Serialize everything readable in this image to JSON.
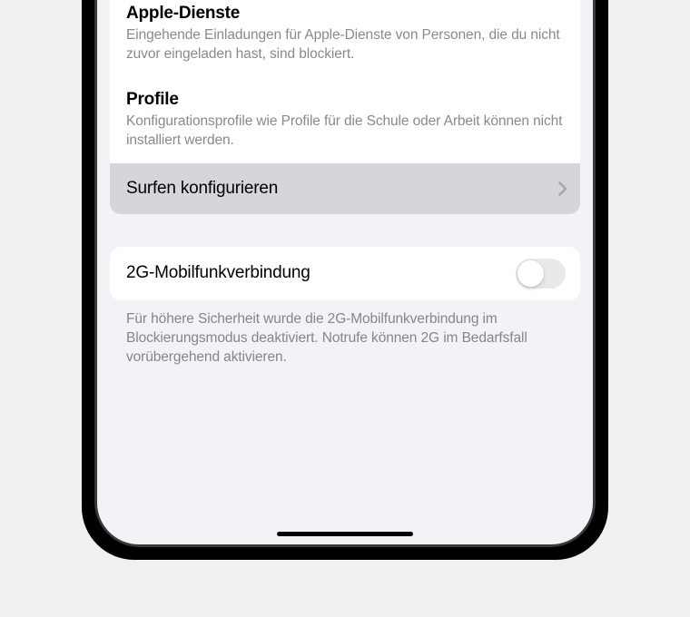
{
  "sections": {
    "apple_services": {
      "title": "Apple-Dienste",
      "description": "Eingehende Einladungen für Apple-Dienste von Personen, die du nicht zuvor eingeladen hast, sind blockiert."
    },
    "profiles": {
      "title": "Profile",
      "description": "Konfigurationsprofile wie Profile für die Schule oder Arbeit können nicht installiert werden."
    },
    "configure_browsing": {
      "label": "Surfen konfigurieren"
    }
  },
  "toggle": {
    "label": "2G-Mobilfunkverbindung",
    "state": "off"
  },
  "footer": {
    "text": "Für höhere Sicherheit wurde die 2G-Mobilfunk­verbindung im Blockierungsmodus deaktiviert. Notrufe können 2G im Bedarfsfall vorübergehend aktivieren."
  }
}
